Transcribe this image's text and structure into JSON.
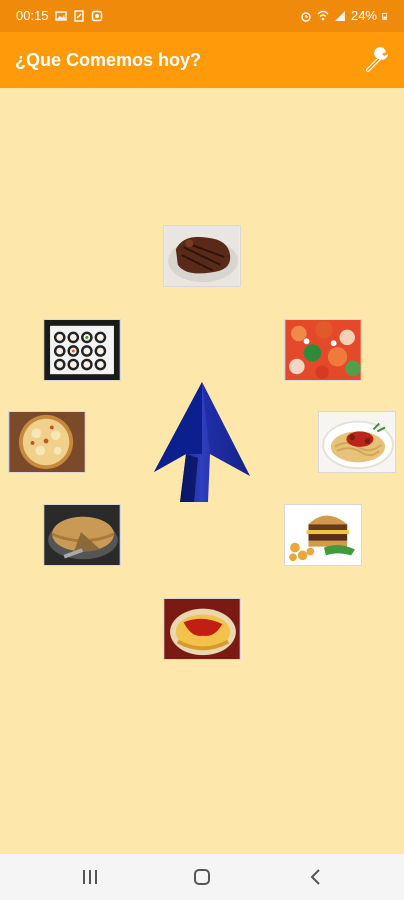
{
  "status_bar": {
    "time": "00:15",
    "battery": "24%"
  },
  "app_bar": {
    "title": "¿Que Comemos hoy?",
    "settings_icon": "wrench-icon"
  },
  "foods": [
    {
      "name": "steak",
      "icon": "steak-image"
    },
    {
      "name": "sushi",
      "icon": "sushi-image"
    },
    {
      "name": "salad",
      "icon": "salad-image"
    },
    {
      "name": "pizza",
      "icon": "pizza-image"
    },
    {
      "name": "spaghetti",
      "icon": "spaghetti-image"
    },
    {
      "name": "pie",
      "icon": "pie-image"
    },
    {
      "name": "burger",
      "icon": "burger-image"
    },
    {
      "name": "omelette",
      "icon": "omelette-image"
    }
  ],
  "spinner": {
    "icon": "arrow-up-icon",
    "color": "#0E1E86"
  },
  "nav_bar": {
    "recents": "recents-icon",
    "home": "home-icon",
    "back": "back-icon"
  }
}
